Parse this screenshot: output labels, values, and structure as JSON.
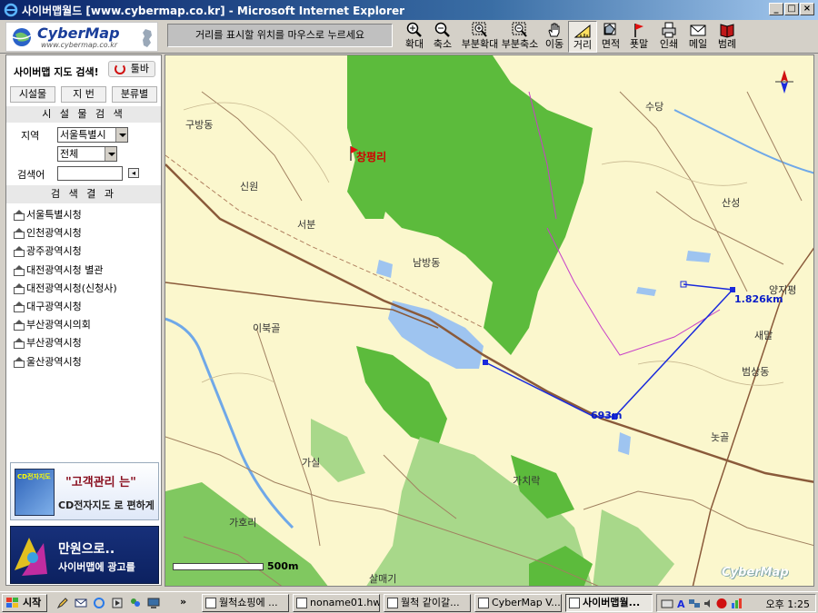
{
  "window": {
    "title": "사이버맵월드 [www.cybermap.co.kr] - Microsoft Internet Explorer",
    "minimize": "_",
    "maximize": "□",
    "close": "×"
  },
  "logo": {
    "brand": "CyberMap",
    "url": "www.cybermap.co.kr"
  },
  "toolbar": {
    "status_message": "거리를 표시할 위치를 마우스로 누르세요",
    "tools": [
      {
        "label": "확대",
        "icon": "zoom-in-icon"
      },
      {
        "label": "축소",
        "icon": "zoom-out-icon"
      },
      {
        "label": "부분확대",
        "icon": "zoom-area-in-icon"
      },
      {
        "label": "부분축소",
        "icon": "zoom-area-out-icon"
      },
      {
        "label": "이동",
        "icon": "hand-icon"
      },
      {
        "label": "거리",
        "icon": "ruler-icon",
        "active": true
      },
      {
        "label": "면적",
        "icon": "area-icon"
      },
      {
        "label": "푯말",
        "icon": "flag-icon"
      },
      {
        "label": "인쇄",
        "icon": "printer-icon"
      },
      {
        "label": "메일",
        "icon": "mail-icon"
      },
      {
        "label": "범례",
        "icon": "book-icon"
      }
    ]
  },
  "left_panel": {
    "search_title": "사이버맵 지도 검색!",
    "toolbar_toggle": "툴바",
    "tabs": [
      "시설물",
      "지 번",
      "분류별"
    ],
    "facility_search_title": "시 설 물 검 색",
    "region_label": "지역",
    "region_value": "서울특별시",
    "subregion_value": "전체",
    "keyword_label": "검색어",
    "keyword_value": "",
    "results_title": "검 색 결 과",
    "results": [
      "서울특별시청",
      "인천광역시청",
      "광주광역시청",
      "대전광역시청 별관",
      "대전광역시청(신청사)",
      "대구광역시청",
      "부산광역시의회",
      "부산광역시청",
      "울산광역시청"
    ],
    "ad1": {
      "badge": "CD전자지도",
      "line1": "\"고객관리 는\"",
      "line2": "CD전자지도 로 편하게"
    },
    "ad2": {
      "line1": "만원으로..",
      "line2": "사이버맵에 광고를"
    }
  },
  "map": {
    "flag_label": "창평리",
    "places": [
      {
        "name": "구방동"
      },
      {
        "name": "신원"
      },
      {
        "name": "서분"
      },
      {
        "name": "남방동"
      },
      {
        "name": "수당"
      },
      {
        "name": "산성"
      },
      {
        "name": "양지평"
      },
      {
        "name": "새말"
      },
      {
        "name": "범상동"
      },
      {
        "name": "이북골"
      },
      {
        "name": "놋골"
      },
      {
        "name": "가실"
      },
      {
        "name": "가치락"
      },
      {
        "name": "가호리"
      },
      {
        "name": "살매기"
      }
    ],
    "distance_labels": [
      "1.826km",
      "693m"
    ],
    "scale_label": "500m",
    "watermark": "CyberMap"
  },
  "taskbar": {
    "start": "시작",
    "tasks": [
      {
        "label": "월척쇼핑에 ..."
      },
      {
        "label": "noname01.hwp"
      },
      {
        "label": "월척 같이갈..."
      },
      {
        "label": "CyberMap V..."
      },
      {
        "label": "사이버맵월...",
        "active": true
      }
    ],
    "clock": "오후 1:25"
  }
}
